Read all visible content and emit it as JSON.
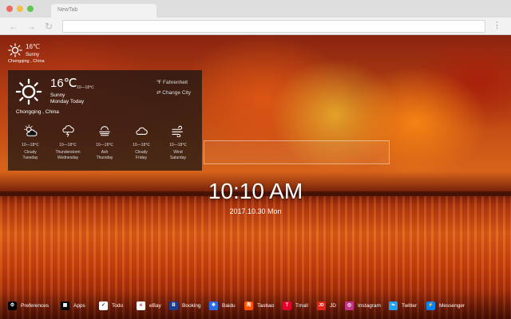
{
  "browser": {
    "tab_title": "NewTab",
    "back_icon": "back-arrow-icon",
    "forward_icon": "forward-arrow-icon",
    "reload_icon": "reload-icon"
  },
  "mini_weather": {
    "temp": "16℃",
    "condition": "Sunny",
    "location": "Chongqing , China"
  },
  "weather": {
    "temp": "16℃",
    "range": "10—18℃",
    "condition": "Sunny",
    "date": "Monday Today",
    "location": "Chongqing , China",
    "unit_option": "℉ Fahrenheit",
    "change_city": "⇄ Change City",
    "forecast": [
      {
        "icon": "sun-cloud-icon",
        "range": "10—18℃",
        "condition": "Cloudy",
        "day": "Tuesday"
      },
      {
        "icon": "thunderstorm-icon",
        "range": "10—18℃",
        "condition": "Thunderstorm",
        "day": "Wednesday"
      },
      {
        "icon": "haze-icon",
        "range": "10—18℃",
        "condition": "Ash",
        "day": "Thursday"
      },
      {
        "icon": "cloud-icon",
        "range": "10—18℃",
        "condition": "Cloudy",
        "day": "Friday"
      },
      {
        "icon": "wind-icon",
        "range": "10—18℃",
        "condition": "Wind",
        "day": "Saturday"
      }
    ]
  },
  "clock": {
    "time": "10:10 AM",
    "date": "2017.10.30 Mon"
  },
  "dock": [
    {
      "label": "Preferences",
      "icon": "gear-icon",
      "color": "#000000",
      "glyph": "⚙"
    },
    {
      "label": "Apps",
      "icon": "apps-grid-icon",
      "color": "#000000",
      "glyph": "▦"
    },
    {
      "label": "Todo",
      "icon": "checkbox-icon",
      "color": "#ffffff",
      "glyph": "✓"
    },
    {
      "label": "eBay",
      "icon": "ebay-icon",
      "color": "#ffffff",
      "glyph": "e"
    },
    {
      "label": "Booking",
      "icon": "booking-icon",
      "color": "#1a3d8f",
      "glyph": "B"
    },
    {
      "label": "Baidu",
      "icon": "baidu-icon",
      "color": "#2b6de5",
      "glyph": "❖"
    },
    {
      "label": "Taobao",
      "icon": "taobao-icon",
      "color": "#ff5000",
      "glyph": "淘"
    },
    {
      "label": "Tmall",
      "icon": "tmall-icon",
      "color": "#e4002b",
      "glyph": "T"
    },
    {
      "label": "JD",
      "icon": "jd-icon",
      "color": "#e1251b",
      "glyph": "JD"
    },
    {
      "label": "Instagram",
      "icon": "instagram-icon",
      "color": "#c13584",
      "glyph": "◎"
    },
    {
      "label": "Twitter",
      "icon": "twitter-icon",
      "color": "#1da1f2",
      "glyph": "❧"
    },
    {
      "label": "Messenger",
      "icon": "messenger-icon",
      "color": "#0084ff",
      "glyph": "⚡"
    }
  ]
}
